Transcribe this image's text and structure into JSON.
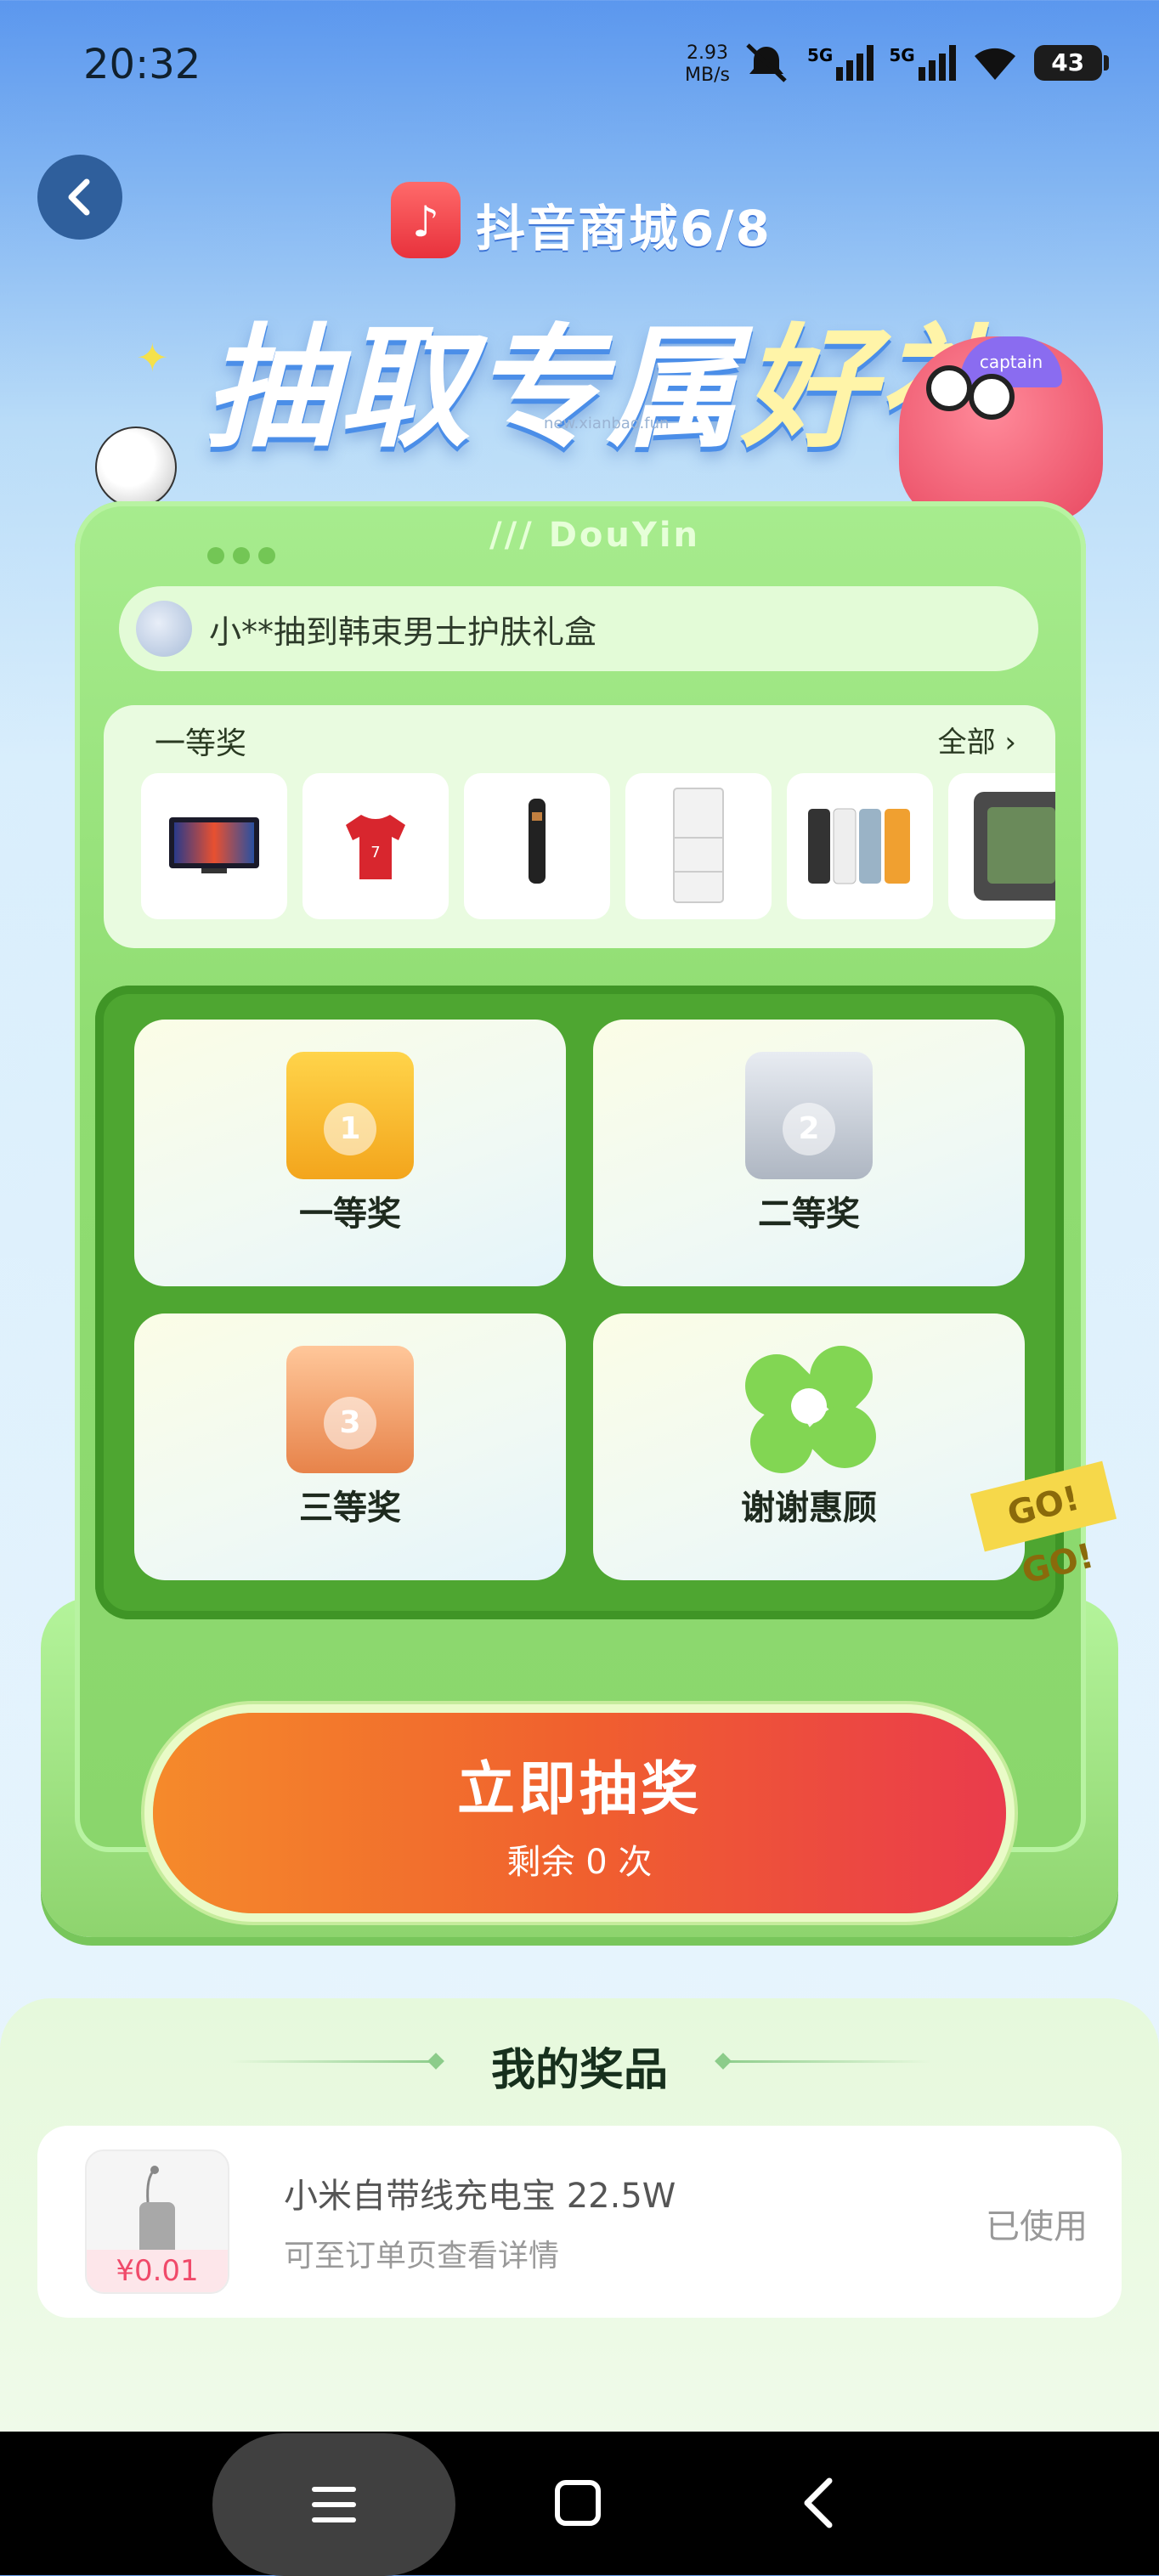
{
  "status_bar": {
    "time": "20:32",
    "speed_value": "2.93",
    "speed_unit": "MB/s",
    "net_1": "5G",
    "net_2": "5G",
    "battery": "43"
  },
  "header": {
    "brand": "抖音商城6/8",
    "headline_part1": "抽取专属",
    "headline_part2": "好礼",
    "watermark": "new.xianbao.fun"
  },
  "machine": {
    "tab_label": "/// DouYin",
    "ticker_text": "小**抽到韩束男士护肤礼盒",
    "prize_panel_title": "一等奖",
    "prize_panel_all": "全部",
    "cells": [
      {
        "label": "一等奖",
        "badge": "1"
      },
      {
        "label": "二等奖",
        "badge": "2"
      },
      {
        "label": "三等奖",
        "badge": "3"
      },
      {
        "label": "谢谢惠顾"
      }
    ],
    "gogo": "GO! GO!"
  },
  "draw_button": {
    "label": "立即抽奖",
    "remaining": "剩余 0 次"
  },
  "my_prizes": {
    "title": "我的奖品",
    "items": [
      {
        "name": "小米自带线充电宝 22.5W",
        "subtitle": "可至订单页查看详情",
        "price": "¥0.01",
        "status": "已使用"
      }
    ]
  },
  "colors": {
    "machine_green": "#90dd72",
    "grid_green": "#4ea631",
    "button_orange": "#f0602e",
    "button_red": "#ea3b4c"
  }
}
